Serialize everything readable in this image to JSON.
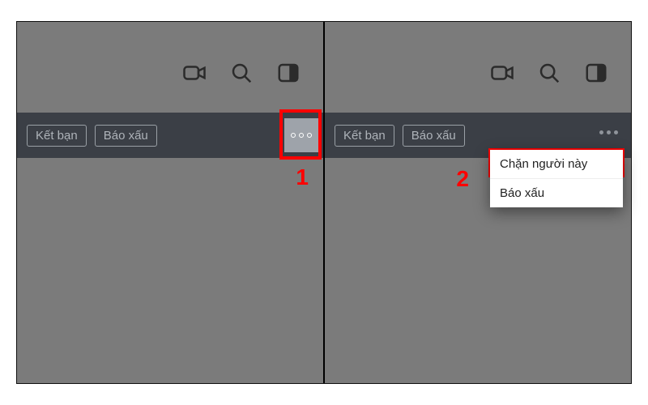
{
  "buttons": {
    "add_friend": "Kết bạn",
    "report": "Báo xấu"
  },
  "menu": {
    "block_user": "Chặn người này",
    "report": "Báo xấu"
  },
  "steps": {
    "one": "1",
    "two": "2"
  }
}
